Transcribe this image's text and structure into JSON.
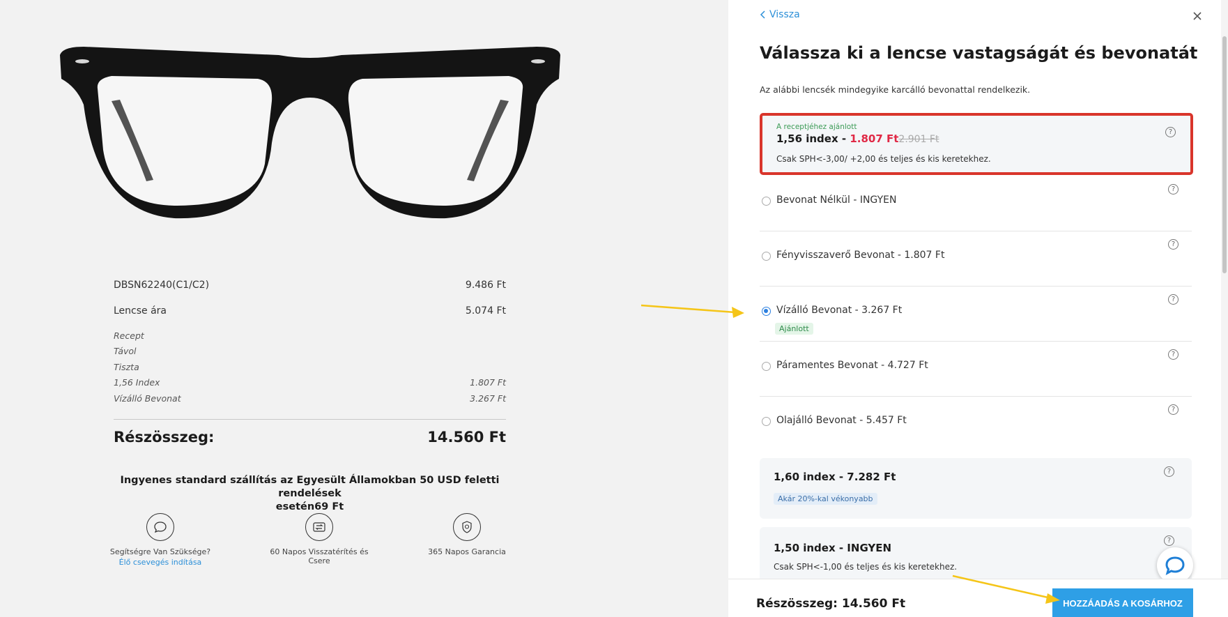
{
  "left": {
    "product": {
      "name": "DBSN62240(C1/C2)",
      "price": "9.486 Ft"
    },
    "lens": {
      "label": "Lencse ára",
      "price": "5.074 Ft"
    },
    "details": [
      {
        "label": "Recept",
        "value": ""
      },
      {
        "label": "Távol",
        "value": ""
      },
      {
        "label": "Tiszta",
        "value": ""
      },
      {
        "label": "1,56 Index",
        "value": "1.807 Ft"
      },
      {
        "label": "Vízálló Bevonat",
        "value": "3.267 Ft"
      }
    ],
    "subtotal_label": "Részösszeg:",
    "subtotal_value": "14.560 Ft",
    "shipping_line1": "Ingyenes standard szállítás az Egyesült Államokban 50 USD feletti rendelések",
    "shipping_line2": "esetén69 Ft",
    "features": [
      {
        "label": "Segítségre Van Szüksége?",
        "link": "Élő csevegés indítása",
        "icon": "chat-bubble-icon"
      },
      {
        "label": "60 Napos Visszatérítés és Csere",
        "icon": "exchange-icon"
      },
      {
        "label": "365 Napos Garancia",
        "icon": "shield-icon"
      }
    ]
  },
  "panel": {
    "back_label": "Vissza",
    "title": "Válassza ki a lencse vastagságát és bevonatát",
    "subtitle": "Az alábbi lencsék mindegyike karcálló bevonattal rendelkezik.",
    "selected": {
      "recommended": "A receptjéhez ajánlott",
      "name": "1,56 index - ",
      "price": "1.807 Ft",
      "old_price": "2.901 Ft",
      "desc": "Csak SPH<-3,00/ +2,00 és teljes és kis keretekhez."
    },
    "options": [
      {
        "label": "Bevonat Nélkül - INGYEN",
        "selected": false
      },
      {
        "label": "Fényvisszaverő Bevonat - 1.807 Ft",
        "selected": false
      },
      {
        "label": "Vízálló Bevonat - 3.267 Ft",
        "selected": true,
        "badge": "Ajánlott"
      },
      {
        "label": "Páramentes Bevonat - 4.727 Ft",
        "selected": false
      },
      {
        "label": "Olajálló Bevonat - 5.457 Ft",
        "selected": false
      }
    ],
    "cards": [
      {
        "name": "1,60 index - 7.282 Ft",
        "badge": "Akár 20%-kal vékonyabb"
      },
      {
        "name": "1,50 index - INGYEN",
        "desc": "Csak SPH<-1,00 és teljes és kis keretekhez."
      }
    ],
    "footer": {
      "subtotal": "Részösszeg: 14.560 Ft",
      "cart_button": "HOZZÁADÁS A KOSÁRHOZ"
    },
    "help_glyph": "?"
  },
  "colors": {
    "accent": "#2e9fe6",
    "price_red": "#e02845",
    "highlight_border": "#d9352b",
    "arrow": "#f5c518",
    "recommended_green": "#3c9b56"
  }
}
